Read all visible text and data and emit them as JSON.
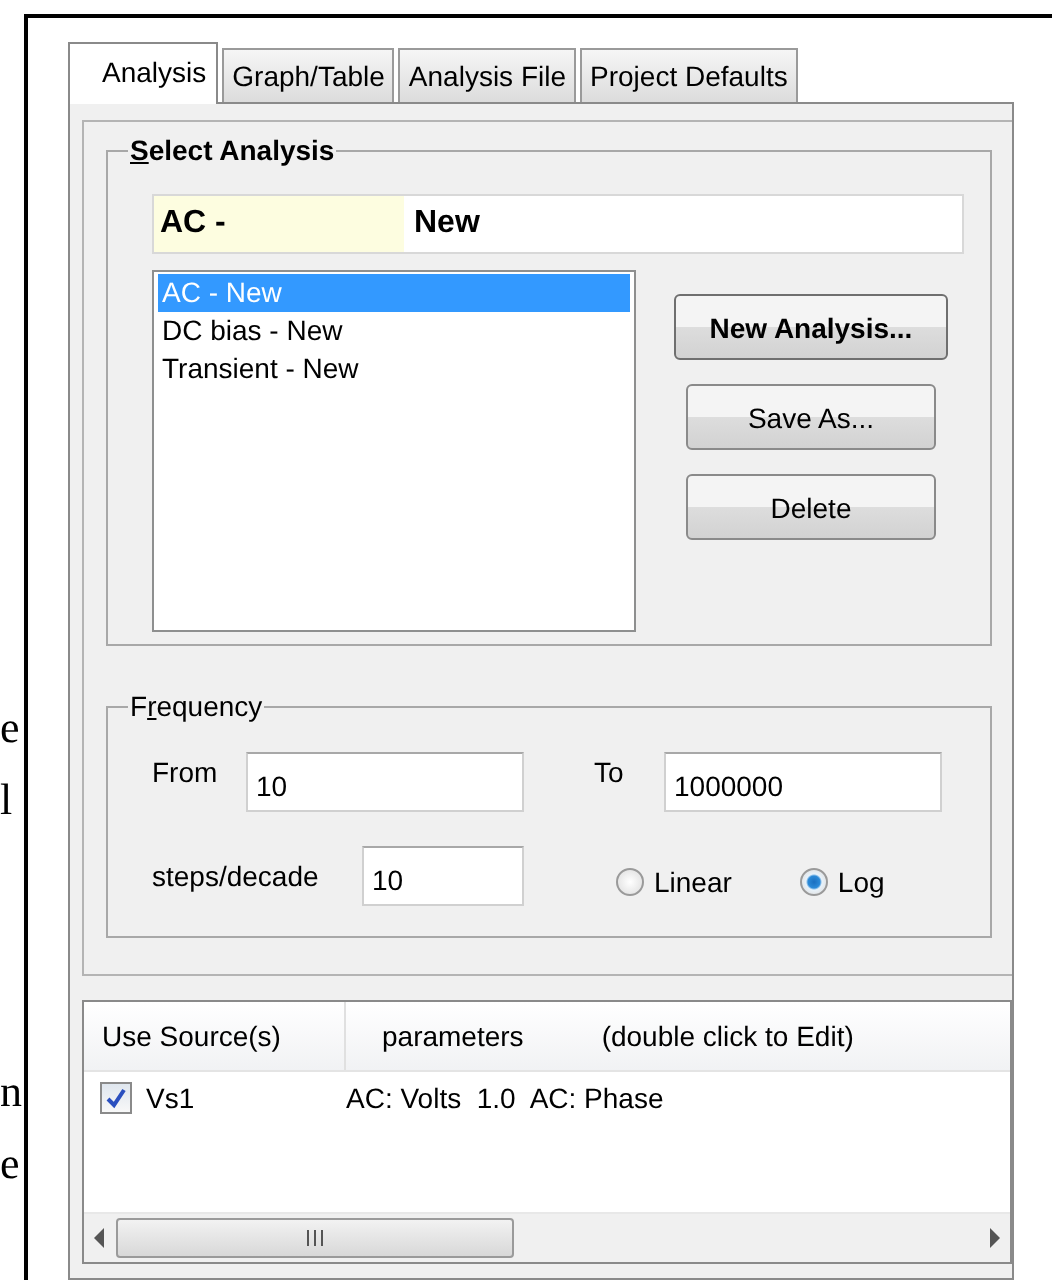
{
  "margin_text": [
    {
      "lines": [
        "e",
        "l"
      ]
    },
    {
      "lines": [
        "n",
        "e"
      ]
    }
  ],
  "tabs": [
    {
      "label": "Analysis",
      "selected": true
    },
    {
      "label": "Graph/Table",
      "selected": false
    },
    {
      "label": "Analysis File",
      "selected": false
    },
    {
      "label": "Project Defaults",
      "selected": false
    }
  ],
  "select_analysis": {
    "title": "Select Analysis",
    "name_prefix": "AC -",
    "name_value": "New",
    "items": [
      {
        "label": "AC - New",
        "selected": true
      },
      {
        "label": "DC bias - New",
        "selected": false
      },
      {
        "label": "Transient - New",
        "selected": false
      }
    ],
    "buttons": [
      {
        "label": "New Analysis...",
        "kind": "default"
      },
      {
        "label": "Save As...",
        "kind": "normal"
      },
      {
        "label": "Delete",
        "kind": "normal"
      }
    ]
  },
  "frequency": {
    "title": "Frequency",
    "from_label": "From",
    "from_value": "10",
    "to_label": "To",
    "to_value": "1000000",
    "steps_label": "steps/decade",
    "steps_value": "10",
    "scales": [
      {
        "label": "Linear",
        "selected": false
      },
      {
        "label": "Log",
        "selected": true
      }
    ]
  },
  "sources": {
    "columns": [
      "Use Source(s)",
      "parameters",
      "(double click to Edit)"
    ],
    "rows": [
      {
        "checked": true,
        "name": "Vs1",
        "parameters": "AC: Volts  1.0  AC: Phase"
      }
    ]
  }
}
